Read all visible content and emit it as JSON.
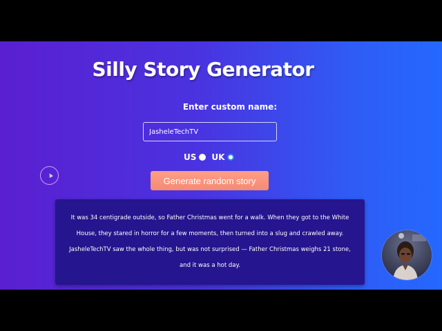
{
  "app": {
    "title": "Silly Story Generator"
  },
  "form": {
    "name_label": "Enter custom name:",
    "name_value": "JasheleTechTV",
    "region_us_label": "US",
    "region_uk_label": "UK",
    "region_selected": "UK",
    "generate_label": "Generate random story"
  },
  "story": {
    "text": "It was 34 centigrade outside, so Father Christmas went for a walk. When they got to the White House, they stared in horror for a few moments, then turned into a slug and crawled away. JasheleTechTV saw the whole thing, but was not surprised — Father Christmas weighs 21 stone, and it was a hot day."
  },
  "colors": {
    "gradient_start": "#5a1fd0",
    "gradient_end": "#2468ff",
    "button": "#f48a74",
    "story_bg": "#25158e",
    "radio_selected_ring": "#2a88ff"
  },
  "icons": {
    "cursor": "cursor-highlight-icon",
    "webcam": "presenter-webcam-icon"
  }
}
